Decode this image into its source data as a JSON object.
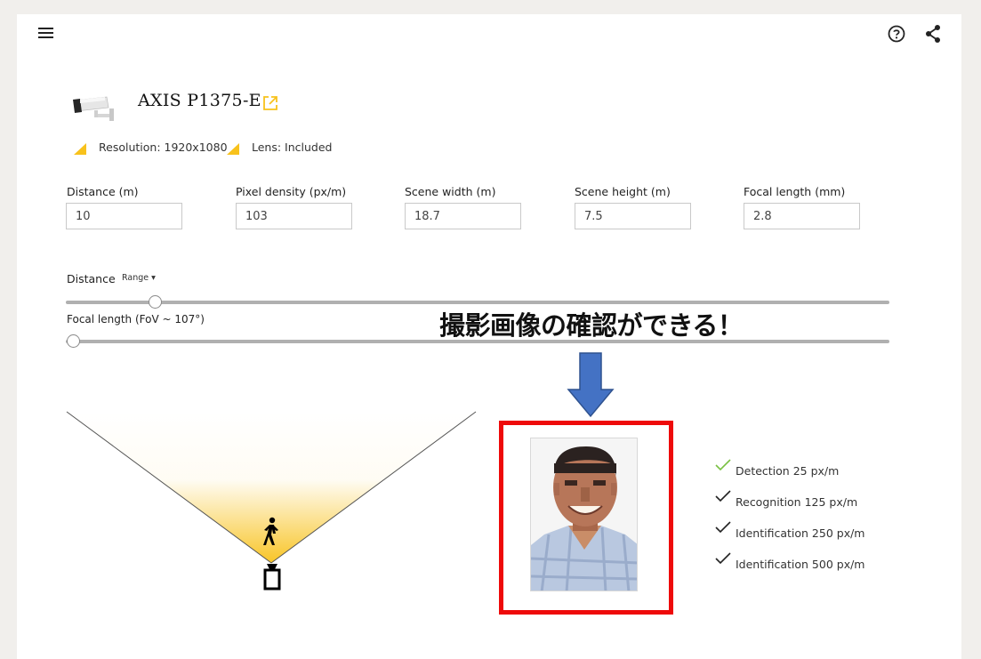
{
  "header": {
    "menu_icon": "hamburger-menu-icon",
    "help_icon": "help-circle-icon",
    "share_icon": "share-icon"
  },
  "product": {
    "name": "AXIS P1375-E",
    "camera_icon": "bullet-camera-icon",
    "external_link_icon": "external-link-icon",
    "resolution": "Resolution: 1920x1080",
    "lens": "Lens: Included"
  },
  "fields": [
    {
      "label": "Distance (m)",
      "value": "10"
    },
    {
      "label": "Pixel density (px/m)",
      "value": "103"
    },
    {
      "label": "Scene width (m)",
      "value": "18.7"
    },
    {
      "label": "Scene height (m)",
      "value": "7.5"
    },
    {
      "label": "Focal length (mm)",
      "value": "2.8"
    }
  ],
  "sliders": {
    "distance": {
      "label": "Distance",
      "mode": "Range",
      "level": 0.1
    },
    "focal": {
      "label": "Focal length (FoV ~ 107°)",
      "level": 0.0
    }
  },
  "annotation": {
    "text": "撮影画像の確認ができる！",
    "arrow_color": "#4472c4",
    "box_color": "#ee0a0a"
  },
  "scene": {
    "person_icon": "walking-person-icon",
    "camera_icon": "camera-position-icon"
  },
  "preview": {
    "image": "pixelated-face-preview"
  },
  "levels": [
    {
      "label": "Detection 25 px/m",
      "met": true,
      "color": "#7ac143"
    },
    {
      "label": "Recognition 125 px/m",
      "met": true,
      "color": "#222222"
    },
    {
      "label": "Identification 250 px/m",
      "met": true,
      "color": "#222222"
    },
    {
      "label": "Identification 500 px/m",
      "met": true,
      "color": "#222222"
    }
  ],
  "colors": {
    "accent": "#f8c21c",
    "background": "#f1efec"
  }
}
